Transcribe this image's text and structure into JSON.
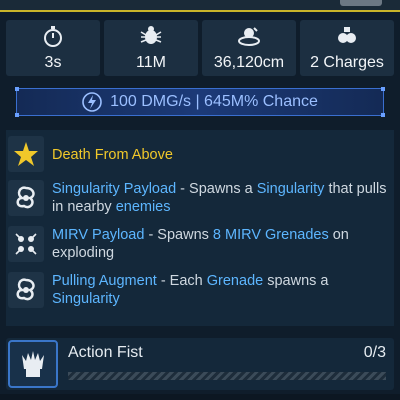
{
  "stats": [
    {
      "icon": "stopwatch-icon",
      "value": "3s"
    },
    {
      "icon": "spider-icon",
      "value": "11M"
    },
    {
      "icon": "orbit-icon",
      "value": "36,120cm"
    },
    {
      "icon": "grenade-icon",
      "value": "2 Charges"
    }
  ],
  "dps": {
    "icon": "lightning-icon",
    "text": "100 DMG/s | 645M% Chance"
  },
  "perks": [
    {
      "icon": "star-badge-icon",
      "title": "Death From Above"
    },
    {
      "icon": "vortex-icon",
      "name": "Singularity Payload",
      "desc1": " - Spawns a ",
      "hl1": "Singularity",
      "desc2": " that pulls in nearby ",
      "hl2": "enemies"
    },
    {
      "icon": "cluster-icon",
      "name": "MIRV Payload",
      "desc1": " - Spawns ",
      "hl1": "8 MIRV Grenades",
      "desc2": " on exploding"
    },
    {
      "icon": "vortex-icon",
      "name": "Pulling Augment",
      "desc1": " - Each ",
      "hl1": "Grenade",
      "desc2": " spawns a ",
      "hl2": "Singularity"
    }
  ],
  "action": {
    "icon": "fist-icon",
    "name": "Action Fist",
    "progress": "0/3",
    "progress_value": 0
  },
  "colors": {
    "accent_blue": "#5db6ff",
    "gold": "#f0c82a",
    "bg": "#0f1d2b",
    "panel": "#14283a"
  }
}
